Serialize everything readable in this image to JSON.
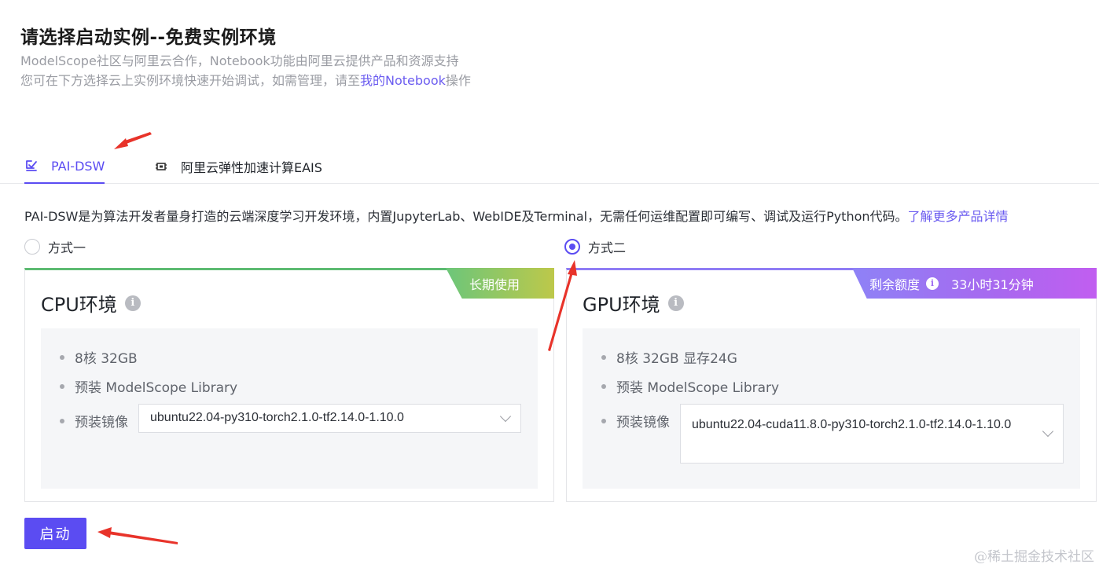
{
  "header": {
    "title": "请选择启动实例--免费实例环境",
    "line1": "ModelScope社区与阿里云合作，Notebook功能由阿里云提供产品和资源支持",
    "line2_prefix": "您可在下方选择云上实例环境快速开始调试，如需管理，请至",
    "line2_link": "我的Notebook",
    "line2_suffix": "操作"
  },
  "tabs": [
    {
      "label": "PAI-DSW",
      "icon": "pai-dsw-icon",
      "active": true
    },
    {
      "label": "阿里云弹性加速计算EAIS",
      "icon": "chip-icon",
      "active": false
    }
  ],
  "description": {
    "text": "PAI-DSW是为算法开发者量身打造的云端深度学习开发环境，内置JupyterLab、WebIDE及Terminal，无需任何运维配置即可编写、调试及运行Python代码。",
    "link": "了解更多产品详情"
  },
  "options": [
    {
      "label": "方式一",
      "selected": false
    },
    {
      "label": "方式二",
      "selected": true
    }
  ],
  "cpu_card": {
    "title": "CPU环境",
    "ribbon": "长期使用",
    "specs": [
      "8核 32GB",
      "预装 ModelScope Library"
    ],
    "image_label": "预装镜像",
    "image_value": "ubuntu22.04-py310-torch2.1.0-tf2.14.0-1.10.0"
  },
  "gpu_card": {
    "title": "GPU环境",
    "ribbon_label": "剩余额度",
    "ribbon_value": "33小时31分钟",
    "specs": [
      "8核 32GB 显存24G",
      "预装 ModelScope Library"
    ],
    "image_label": "预装镜像",
    "image_value": "ubuntu22.04-cuda11.8.0-py310-torch2.1.0-tf2.14.0-1.10.0"
  },
  "start_button": "启动",
  "watermark": "@稀土掘金技术社区",
  "colors": {
    "accent": "#5b4cf2",
    "cpu_ribbon": "#6cc67a",
    "gpu_ribbon": "#a868ef",
    "annotation_arrow": "#e8332a"
  }
}
